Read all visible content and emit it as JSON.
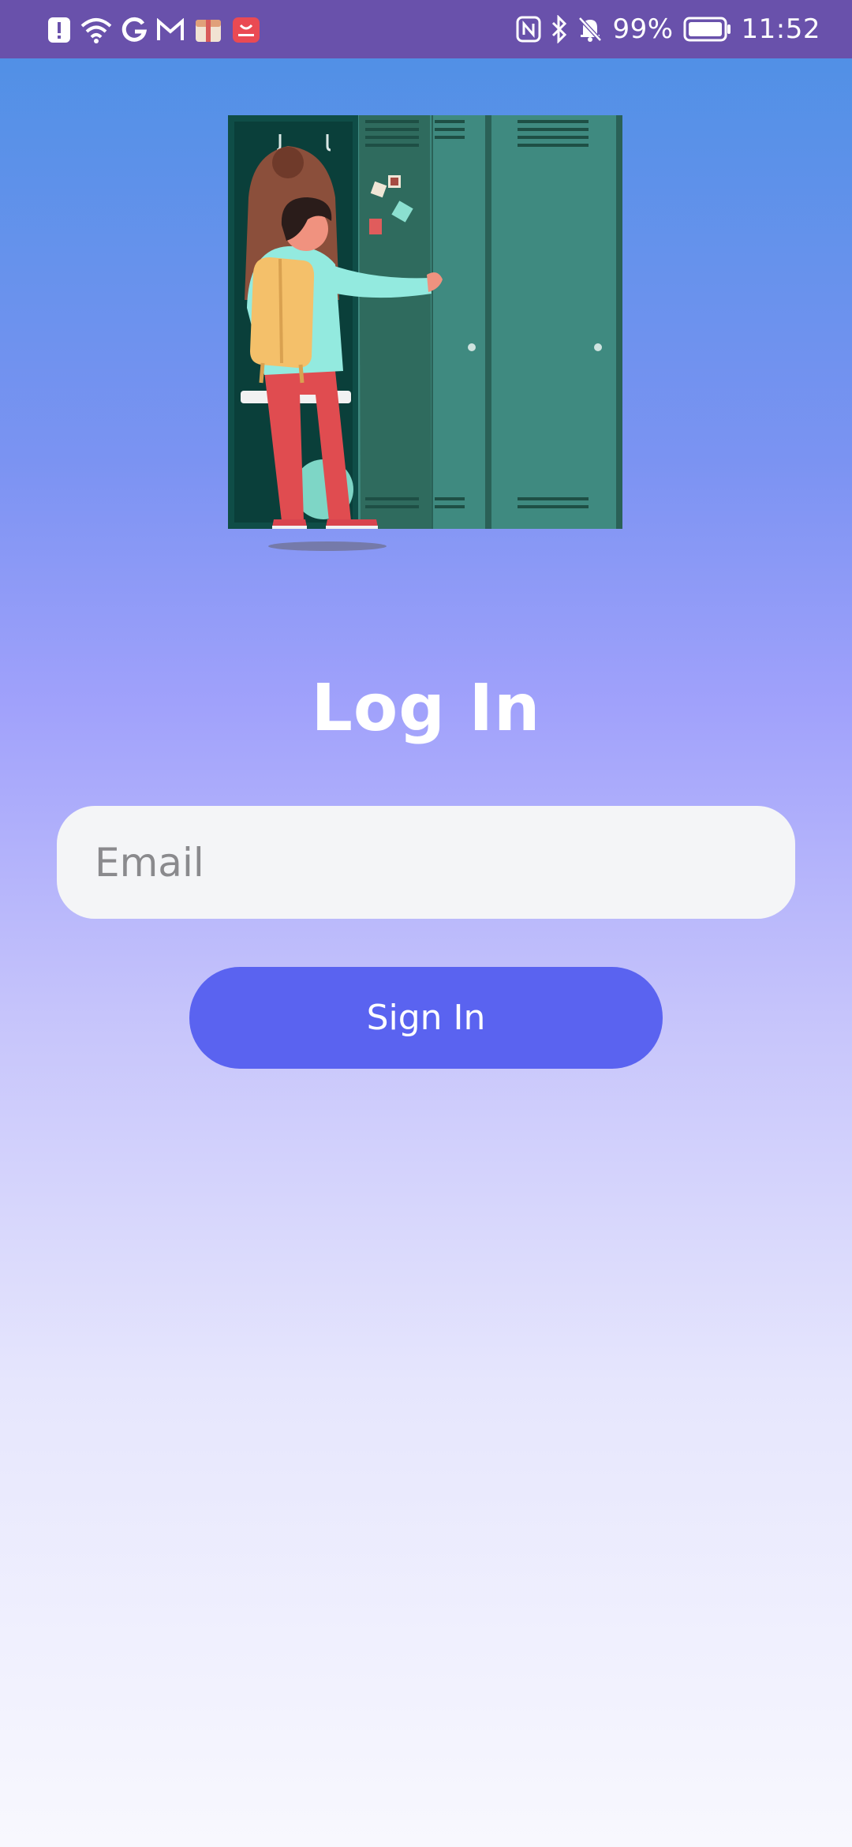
{
  "status_bar": {
    "battery_percent": "99%",
    "time": "11:52",
    "left_icons": [
      "alert-icon",
      "wifi-icon",
      "google-icon",
      "gmail-icon",
      "gift-box-icon",
      "huawei-app-icon"
    ],
    "right_icons": [
      "nfc-icon",
      "bluetooth-icon",
      "mute-bell-icon",
      "battery-icon"
    ],
    "background_color": "#6951ab"
  },
  "illustration": {
    "icon": "student-at-locker-illustration"
  },
  "login": {
    "title": "Log In",
    "email_placeholder": "Email",
    "email_value": "",
    "sign_in_label": "Sign In",
    "button_color": "#5a63f0"
  }
}
